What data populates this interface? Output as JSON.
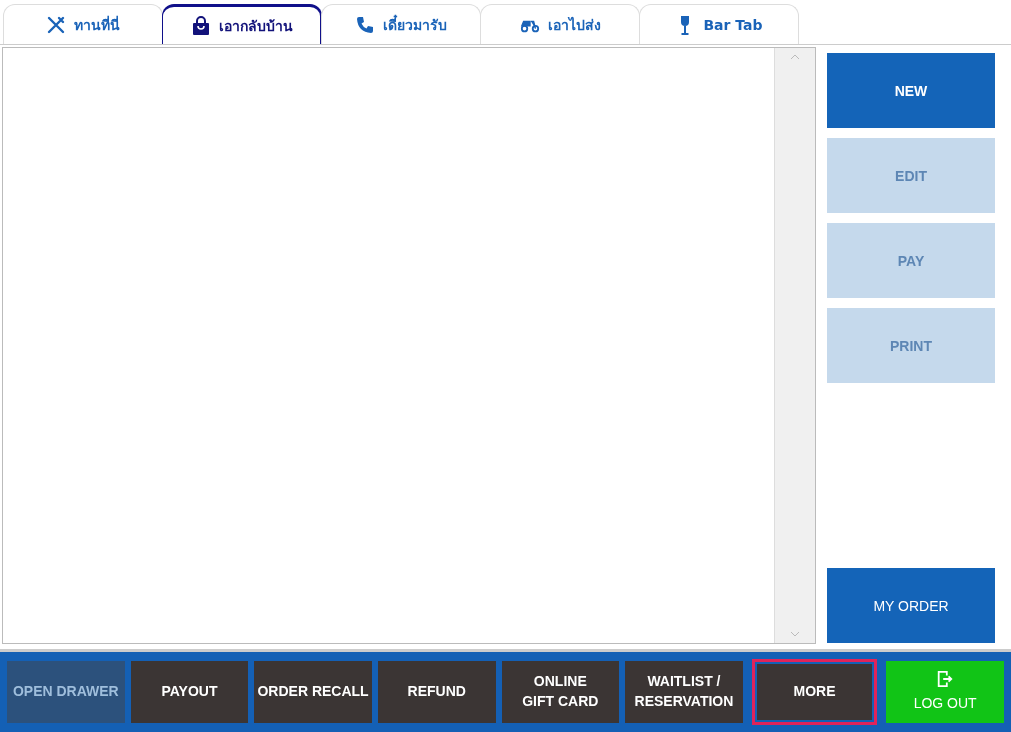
{
  "tabs": [
    {
      "label": "ทานที่นี่",
      "selected": false
    },
    {
      "label": "เอากลับบ้าน",
      "selected": true
    },
    {
      "label": "เดี๋ยวมารับ",
      "selected": false
    },
    {
      "label": "เอาไปส่ง",
      "selected": false
    },
    {
      "label": "Bar Tab",
      "selected": false
    }
  ],
  "side_buttons": [
    {
      "label": "NEW",
      "disabled": false,
      "bold": true
    },
    {
      "label": "EDIT",
      "disabled": true,
      "bold": true
    },
    {
      "label": "PAY",
      "disabled": true,
      "bold": true
    },
    {
      "label": "PRINT",
      "disabled": true,
      "bold": true
    },
    {
      "label": "MY ORDER",
      "disabled": false,
      "bold": false
    }
  ],
  "bottom_buttons": [
    {
      "label": "OPEN DRAWER",
      "kind": "action",
      "disabled": true,
      "highlighted": false
    },
    {
      "label": "PAYOUT",
      "kind": "action",
      "disabled": false,
      "highlighted": false
    },
    {
      "label": "ORDER RECALL",
      "kind": "action",
      "disabled": false,
      "highlighted": false
    },
    {
      "label": "REFUND",
      "kind": "action",
      "disabled": false,
      "highlighted": false
    },
    {
      "label": "ONLINE\nGIFT CARD",
      "kind": "action",
      "disabled": false,
      "highlighted": false
    },
    {
      "label": "WAITLIST /\nRESERVATION",
      "kind": "action",
      "disabled": false,
      "highlighted": false
    },
    {
      "label": "MORE",
      "kind": "action",
      "disabled": false,
      "highlighted": true
    },
    {
      "label": "LOG OUT",
      "kind": "logout",
      "disabled": false,
      "highlighted": false
    }
  ]
}
